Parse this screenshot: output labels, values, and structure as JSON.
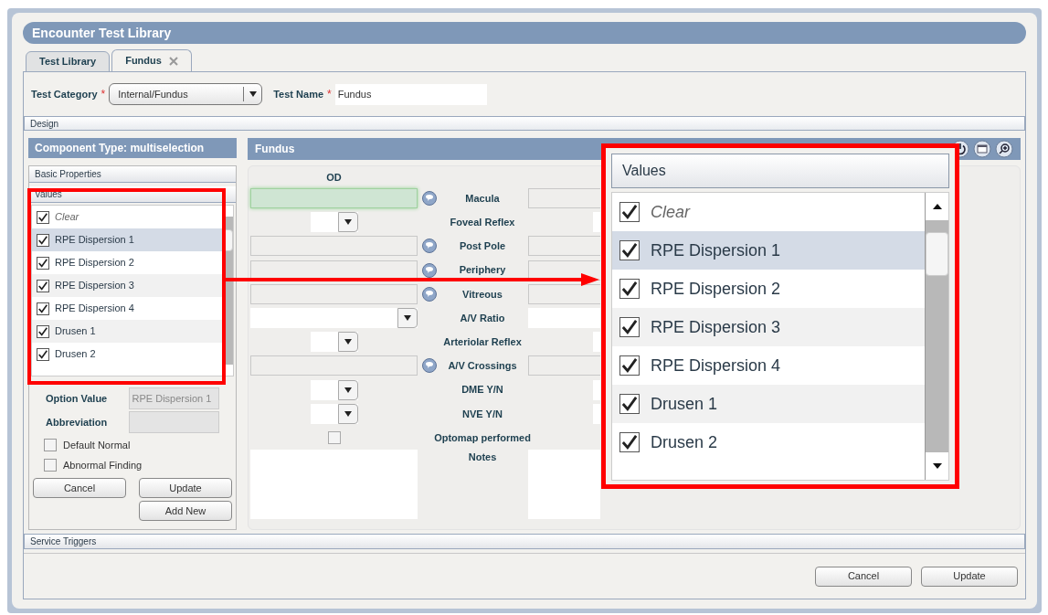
{
  "window": {
    "title": "Encounter Test Library"
  },
  "tabs": [
    {
      "label": "Test Library",
      "selected": false,
      "closable": false
    },
    {
      "label": "Fundus",
      "selected": true,
      "closable": true
    }
  ],
  "header_fields": [
    {
      "label": "Test Category",
      "required_mark": "*",
      "kind": "dropdown",
      "value": "Internal/Fundus"
    },
    {
      "label": "Test Name",
      "required_mark": "*",
      "kind": "text",
      "value": "Fundus"
    }
  ],
  "design_section": "Design",
  "component_panel": {
    "title": "Component Type: multiselection",
    "basic_properties": "Basic Properties",
    "values_header": "Values",
    "values": [
      {
        "label": "Clear",
        "kind": "clear",
        "checked": true,
        "selected": false
      },
      {
        "label": "RPE Dispersion 1",
        "kind": "value",
        "checked": true,
        "selected": true
      },
      {
        "label": "RPE Dispersion 2",
        "kind": "value",
        "checked": true,
        "selected": false
      },
      {
        "label": "RPE Dispersion 3",
        "kind": "value",
        "checked": true,
        "selected": false
      },
      {
        "label": "RPE Dispersion 4",
        "kind": "value",
        "checked": true,
        "selected": false
      },
      {
        "label": "Drusen 1",
        "kind": "value",
        "checked": true,
        "selected": false
      },
      {
        "label": "Drusen 2",
        "kind": "value",
        "checked": true,
        "selected": false
      }
    ],
    "option_value": {
      "label": "Option Value",
      "value": "RPE Dispersion 1",
      "disabled": true
    },
    "abbreviation": {
      "label": "Abbreviation"
    },
    "checkboxes": [
      {
        "label": "Default Normal",
        "checked": false
      },
      {
        "label": "Abnormal Finding",
        "checked": false
      }
    ],
    "buttons": [
      "Cancel",
      "Update",
      "Add New"
    ]
  },
  "preview_panel": {
    "title": "Fundus",
    "column": "OD",
    "rows": [
      {
        "label": "Macula",
        "kind": "text",
        "comment": true,
        "focused": true
      },
      {
        "label": "Foveal Reflex",
        "kind": "dropdown",
        "comment": false,
        "focused": false
      },
      {
        "label": "Post Pole",
        "kind": "text",
        "comment": true,
        "focused": false
      },
      {
        "label": "Periphery",
        "kind": "text",
        "comment": true,
        "focused": false
      },
      {
        "label": "Vitreous",
        "kind": "text",
        "comment": true,
        "focused": false
      },
      {
        "label": "A/V Ratio",
        "kind": "wide-dropdown",
        "comment": false,
        "focused": false
      },
      {
        "label": "Arteriolar Reflex",
        "kind": "dropdown",
        "comment": false,
        "focused": false
      },
      {
        "label": "A/V Crossings",
        "kind": "text",
        "comment": true,
        "focused": false
      },
      {
        "label": "DME Y/N",
        "kind": "dropdown",
        "comment": false,
        "focused": false
      },
      {
        "label": "NVE Y/N",
        "kind": "dropdown",
        "comment": false,
        "focused": false
      },
      {
        "label": "Optomap performed",
        "kind": "checkbox",
        "comment": false,
        "focused": false,
        "checked": false
      },
      {
        "label": "Notes",
        "kind": "textarea",
        "comment": false,
        "focused": false
      }
    ]
  },
  "service_triggers": "Service Triggers",
  "footer_buttons": [
    "Cancel",
    "Update"
  ],
  "callout": {
    "header": "Values",
    "values": [
      {
        "label": "Clear",
        "kind": "clear",
        "checked": true,
        "selected": false
      },
      {
        "label": "RPE Dispersion 1",
        "kind": "value",
        "checked": true,
        "selected": true
      },
      {
        "label": "RPE Dispersion 2",
        "kind": "value",
        "checked": true,
        "selected": false
      },
      {
        "label": "RPE Dispersion 3",
        "kind": "value",
        "checked": true,
        "selected": false
      },
      {
        "label": "RPE Dispersion 4",
        "kind": "value",
        "checked": true,
        "selected": false
      },
      {
        "label": "Drusen 1",
        "kind": "value",
        "checked": true,
        "selected": false
      },
      {
        "label": "Drusen 2",
        "kind": "value",
        "checked": true,
        "selected": false
      }
    ]
  }
}
